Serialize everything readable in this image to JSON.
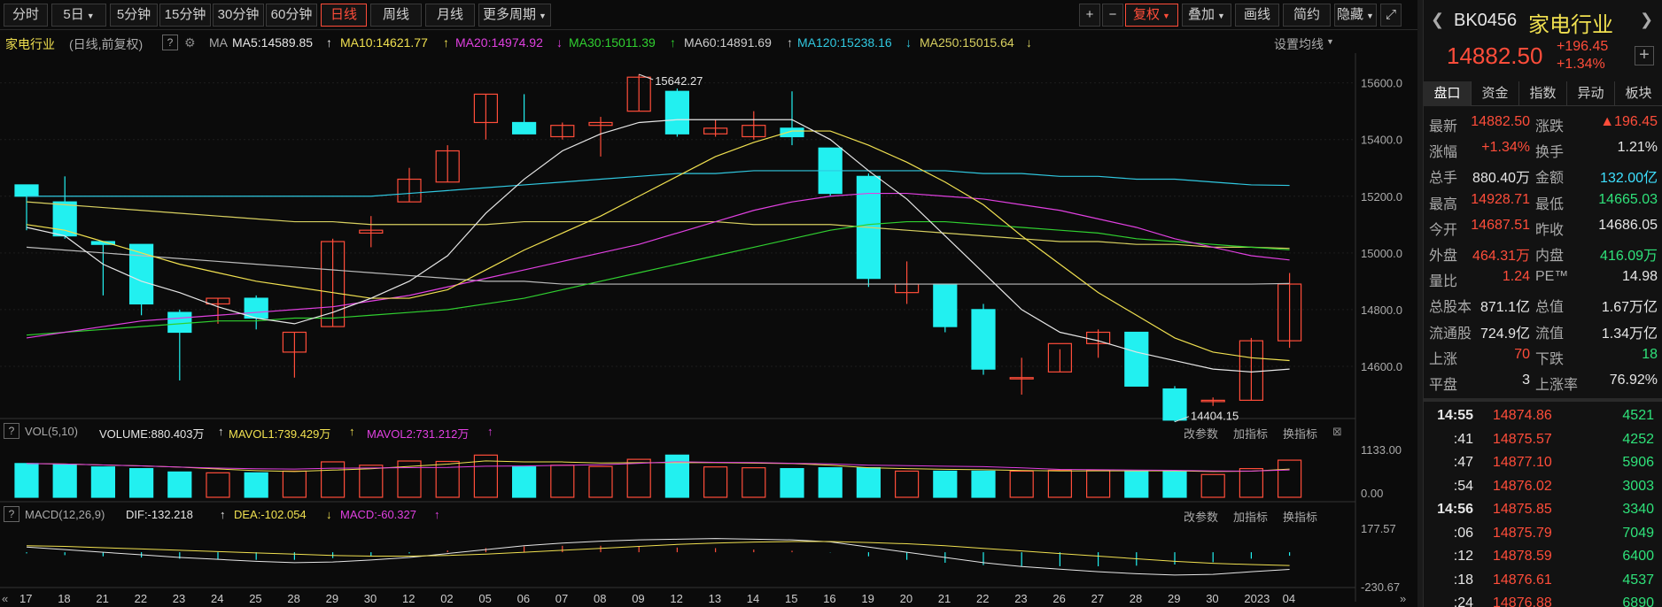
{
  "toolbar": {
    "periods": [
      {
        "label": "分时",
        "active": false
      },
      {
        "label": "5日",
        "active": false,
        "dropdown": true
      },
      {
        "label": "5分钟",
        "active": false
      },
      {
        "label": "15分钟",
        "active": false
      },
      {
        "label": "30分钟",
        "active": false
      },
      {
        "label": "60分钟",
        "active": false
      },
      {
        "label": "日线",
        "active": true
      },
      {
        "label": "周线",
        "active": false
      },
      {
        "label": "月线",
        "active": false
      },
      {
        "label": "更多周期",
        "active": false,
        "dropdown": true
      }
    ],
    "zoom_in": "+",
    "zoom_out": "−",
    "fuquan": "复权",
    "overlay": "叠加",
    "draw": "画线",
    "simple": "简约",
    "hide": "隐藏"
  },
  "ma_row": {
    "name": "家电行业",
    "mode": "(日线,前复权)",
    "help": "?",
    "ma_label": "MA",
    "ma5": "MA5:14589.85",
    "ma10": "MA10:14621.77",
    "ma20": "MA20:14974.92",
    "ma30": "MA30:15011.39",
    "ma60": "MA60:14891.69",
    "ma120": "MA120:15238.16",
    "ma250": "MA250:15015.64",
    "set_ma": "设置均线",
    "arrows": {
      "ma5": "↑",
      "ma10": "↑",
      "ma20": "↓",
      "ma30": "↑",
      "ma60": "↑",
      "ma120": "↓",
      "ma250": "↓"
    }
  },
  "vol_row": {
    "help": "?",
    "name": "VOL(5,10)",
    "volume": "VOLUME:880.403万",
    "mavol1": "MAVOL1:739.429万",
    "mavol2": "MAVOL2:731.212万",
    "arrows": [
      "↑",
      "↑",
      "↑"
    ],
    "btn_params": "改参数",
    "btn_add": "加指标",
    "btn_switch": "换指标"
  },
  "macd_row": {
    "help": "?",
    "name": "MACD(12,26,9)",
    "dif": "DIF:-132.218",
    "dea": "DEA:-102.054",
    "macd": "MACD:-60.327",
    "arrows": [
      "↑",
      "↓",
      "↑"
    ],
    "btn_params": "改参数",
    "btn_add": "加指标",
    "btn_switch": "换指标"
  },
  "colors": {
    "up": "#ff4d3a",
    "down": "#22f0f0",
    "ma5": "#e6e6e6",
    "ma10": "#f0e050",
    "ma20": "#e040e0",
    "ma30": "#30d030",
    "ma60": "#bbbbbb",
    "ma120": "#30c8e0",
    "ma250": "#d8d060"
  },
  "chart_data": {
    "type": "candlestick",
    "x": [
      "17",
      "18",
      "21",
      "22",
      "23",
      "24",
      "25",
      "28",
      "29",
      "30",
      "12",
      "02",
      "05",
      "06",
      "07",
      "08",
      "09",
      "12",
      "13",
      "14",
      "15",
      "16",
      "19",
      "20",
      "21",
      "22",
      "23",
      "26",
      "27",
      "28",
      "29",
      "30",
      "2023",
      "04"
    ],
    "tick_labels": [
      "17",
      "18",
      "21",
      "22",
      "23",
      "24",
      "25",
      "28",
      "29",
      "30",
      "12",
      "02",
      "05",
      "06",
      "07",
      "08",
      "09",
      "12",
      "13",
      "14",
      "15",
      "16",
      "19",
      "20",
      "21",
      "22",
      "23",
      "26",
      "27",
      "28",
      "29",
      "30",
      "2023",
      "04"
    ],
    "y_ticks": [
      15600,
      15400,
      15200,
      15000,
      14800,
      14600
    ],
    "y_tick_labels": [
      "15600.0",
      "15400.0",
      "15200.0",
      "15000.0",
      "14800.0",
      "14600.0"
    ],
    "ylim": [
      14400,
      15680
    ],
    "high_label": "15642.27",
    "low_label": "14404.15",
    "ohlc": [
      [
        15240,
        15240,
        15080,
        15200
      ],
      [
        15180,
        15270,
        15050,
        15060
      ],
      [
        15040,
        15040,
        14850,
        15030
      ],
      [
        15030,
        15030,
        14780,
        14820
      ],
      [
        14790,
        14800,
        14550,
        14720
      ],
      [
        14820,
        14840,
        14750,
        14840
      ],
      [
        14840,
        14850,
        14730,
        14770
      ],
      [
        14650,
        14720,
        14560,
        14720
      ],
      [
        14740,
        15050,
        14740,
        15040
      ],
      [
        15070,
        15130,
        15020,
        15080
      ],
      [
        15180,
        15300,
        15180,
        15260
      ],
      [
        15250,
        15380,
        15250,
        15360
      ],
      [
        15460,
        15560,
        15400,
        15560
      ],
      [
        15460,
        15560,
        15430,
        15420
      ],
      [
        15410,
        15460,
        15400,
        15450
      ],
      [
        15450,
        15480,
        15340,
        15460
      ],
      [
        15500,
        15630,
        15500,
        15620
      ],
      [
        15570,
        15580,
        15410,
        15420
      ],
      [
        15420,
        15470,
        15410,
        15440
      ],
      [
        15410,
        15500,
        15400,
        15450
      ],
      [
        15440,
        15570,
        15380,
        15410
      ],
      [
        15370,
        15370,
        15200,
        15210
      ],
      [
        15270,
        15280,
        14880,
        14910
      ],
      [
        14860,
        14970,
        14820,
        14890
      ],
      [
        14890,
        14890,
        14720,
        14740
      ],
      [
        14800,
        14820,
        14570,
        14590
      ],
      [
        14560,
        14630,
        14500,
        14560
      ],
      [
        14580,
        14660,
        14580,
        14680
      ],
      [
        14680,
        14730,
        14630,
        14720
      ],
      [
        14720,
        14720,
        14530,
        14530
      ],
      [
        14520,
        14530,
        14404,
        14410
      ],
      [
        14480,
        14490,
        14460,
        14480
      ],
      [
        14480,
        14700,
        14480,
        14690
      ],
      [
        14690,
        14929,
        14665,
        14890
      ]
    ],
    "ma5": [
      15090,
      15060,
      14960,
      14900,
      14860,
      14810,
      14770,
      14750,
      14790,
      14840,
      14900,
      14990,
      15140,
      15260,
      15360,
      15420,
      15460,
      15470,
      15470,
      15470,
      15470,
      15400,
      15290,
      15190,
      15060,
      14930,
      14800,
      14720,
      14690,
      14650,
      14620,
      14590,
      14580,
      14590
    ],
    "ma10": [
      15100,
      15080,
      15040,
      15000,
      14960,
      14930,
      14900,
      14880,
      14860,
      14840,
      14840,
      14870,
      14940,
      15010,
      15070,
      15130,
      15200,
      15270,
      15340,
      15390,
      15430,
      15430,
      15380,
      15320,
      15250,
      15170,
      15060,
      14960,
      14860,
      14780,
      14700,
      14650,
      14630,
      14620
    ],
    "ma20": [
      14700,
      14720,
      14740,
      14760,
      14770,
      14780,
      14790,
      14800,
      14810,
      14830,
      14850,
      14880,
      14910,
      14940,
      14970,
      15000,
      15030,
      15070,
      15110,
      15150,
      15180,
      15200,
      15210,
      15210,
      15200,
      15190,
      15170,
      15150,
      15120,
      15090,
      15050,
      15020,
      14990,
      14975
    ],
    "ma30": [
      14710,
      14720,
      14730,
      14740,
      14750,
      14760,
      14760,
      14770,
      14770,
      14780,
      14790,
      14800,
      14820,
      14840,
      14870,
      14900,
      14930,
      14960,
      14990,
      15020,
      15050,
      15080,
      15100,
      15110,
      15110,
      15100,
      15090,
      15080,
      15070,
      15050,
      15040,
      15030,
      15020,
      15011
    ],
    "ma60": [
      15020,
      15010,
      15000,
      14990,
      14980,
      14970,
      14960,
      14950,
      14940,
      14930,
      14920,
      14910,
      14900,
      14900,
      14890,
      14890,
      14890,
      14890,
      14890,
      14890,
      14890,
      14890,
      14890,
      14890,
      14890,
      14890,
      14890,
      14890,
      14890,
      14890,
      14890,
      14890,
      14890,
      14892
    ],
    "ma120": [
      15200,
      15200,
      15200,
      15200,
      15200,
      15200,
      15200,
      15200,
      15200,
      15200,
      15210,
      15220,
      15230,
      15240,
      15250,
      15260,
      15270,
      15280,
      15280,
      15290,
      15290,
      15290,
      15290,
      15290,
      15290,
      15280,
      15280,
      15270,
      15270,
      15260,
      15260,
      15250,
      15240,
      15238
    ],
    "ma250": [
      15180,
      15170,
      15160,
      15150,
      15140,
      15130,
      15120,
      15110,
      15110,
      15100,
      15100,
      15100,
      15100,
      15110,
      15110,
      15110,
      15110,
      15110,
      15110,
      15100,
      15100,
      15100,
      15090,
      15080,
      15070,
      15060,
      15050,
      15040,
      15040,
      15030,
      15030,
      15020,
      15020,
      15016
    ],
    "volume": [
      800,
      780,
      720,
      680,
      600,
      580,
      580,
      620,
      840,
      760,
      860,
      850,
      1000,
      720,
      760,
      730,
      900,
      1000,
      720,
      700,
      680,
      700,
      700,
      620,
      620,
      620,
      620,
      640,
      640,
      620,
      620,
      540,
      680,
      880
    ],
    "vol_ticks": [
      "1133.00",
      "0.00"
    ],
    "vol_max": 1133,
    "macd_ticks": [
      "177.57",
      "-230.67"
    ],
    "macd_range": [
      -230.67,
      177.57
    ],
    "dif": [
      40,
      20,
      0,
      -20,
      -40,
      -55,
      -70,
      -80,
      -75,
      -60,
      -40,
      -10,
      20,
      50,
      70,
      85,
      95,
      100,
      105,
      100,
      95,
      80,
      40,
      0,
      -40,
      -80,
      -110,
      -130,
      -150,
      -165,
      -175,
      -170,
      -150,
      -132
    ],
    "dea": [
      50,
      45,
      35,
      25,
      15,
      5,
      -5,
      -15,
      -25,
      -30,
      -30,
      -25,
      -15,
      0,
      15,
      30,
      45,
      60,
      70,
      78,
      82,
      82,
      75,
      65,
      50,
      30,
      10,
      -10,
      -30,
      -50,
      -70,
      -85,
      -95,
      -102
    ],
    "macd": [
      -20,
      -50,
      -70,
      -90,
      -110,
      -120,
      -130,
      -130,
      -100,
      -60,
      -20,
      30,
      70,
      100,
      110,
      110,
      100,
      80,
      70,
      45,
      25,
      -5,
      -70,
      -130,
      -180,
      -220,
      -240,
      -240,
      -240,
      -230,
      -210,
      -170,
      -110,
      -60
    ]
  },
  "right_panel": {
    "code": "BK0456",
    "name": "家电行业",
    "price": "14882.50",
    "change": "+196.45",
    "change_pct": "+1.34%",
    "plus": "+",
    "tabs": [
      "盘口",
      "资金",
      "指数",
      "异动",
      "板块"
    ],
    "quote_rows": [
      {
        "l1": "最新",
        "v1": "14882.50",
        "c1": "red",
        "l2": "涨跌",
        "v2": "▲196.45",
        "c2": "red"
      },
      {
        "l1": "涨幅",
        "v1": "+1.34%",
        "c1": "red",
        "l2": "换手",
        "v2": "1.21%",
        "c2": "white"
      },
      {
        "l1": "总手",
        "v1": "880.40万",
        "c1": "white",
        "l2": "金额",
        "v2": "132.00亿",
        "c2": "cyan"
      },
      {
        "l1": "最高",
        "v1": "14928.71",
        "c1": "red",
        "l2": "最低",
        "v2": "14665.03",
        "c2": "green"
      },
      {
        "l1": "今开",
        "v1": "14687.51",
        "c1": "red",
        "l2": "昨收",
        "v2": "14686.05",
        "c2": "white"
      },
      {
        "l1": "外盘",
        "v1": "464.31万",
        "c1": "red",
        "l2": "内盘",
        "v2": "416.09万",
        "c2": "green"
      },
      {
        "l1": "量比",
        "v1": "1.24",
        "c1": "red",
        "l2": "PE™",
        "v2": "14.98",
        "c2": "white"
      },
      {
        "l1": "总股本",
        "v1": "871.1亿",
        "c1": "white",
        "l2": "总值",
        "v2": "1.67万亿",
        "c2": "white"
      },
      {
        "l1": "流通股",
        "v1": "724.9亿",
        "c1": "white",
        "l2": "流值",
        "v2": "1.34万亿",
        "c2": "white"
      },
      {
        "l1": "上涨",
        "v1": "70",
        "c1": "red",
        "l2": "下跌",
        "v2": "18",
        "c2": "green"
      },
      {
        "l1": "平盘",
        "v1": "3",
        "c1": "white",
        "l2": "上涨率",
        "v2": "76.92%",
        "c2": "white"
      }
    ],
    "trades": [
      {
        "t": "14:55",
        "p": "14874.86",
        "v": "4521",
        "bold": true
      },
      {
        "t": ":41",
        "p": "14875.57",
        "v": "4252",
        "bold": false
      },
      {
        "t": ":47",
        "p": "14877.10",
        "v": "5906",
        "bold": false
      },
      {
        "t": ":54",
        "p": "14876.02",
        "v": "3003",
        "bold": false
      },
      {
        "t": "14:56",
        "p": "14875.85",
        "v": "3340",
        "bold": true
      },
      {
        "t": ":06",
        "p": "14875.79",
        "v": "7049",
        "bold": false
      },
      {
        "t": ":12",
        "p": "14878.59",
        "v": "6400",
        "bold": false
      },
      {
        "t": ":18",
        "p": "14876.61",
        "v": "4537",
        "bold": false
      },
      {
        "t": ":24",
        "p": "14876.88",
        "v": "6890",
        "bold": false
      }
    ]
  }
}
